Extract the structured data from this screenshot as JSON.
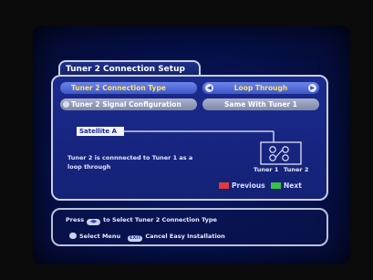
{
  "title": "Tuner 2 Connection Setup",
  "rows": [
    {
      "label": "Tuner 2 Connection Type",
      "value": "Loop Through"
    },
    {
      "label": "Tuner 2 Signal Configuration",
      "value": "Same With Tuner 1"
    }
  ],
  "arrows": {
    "left": "◀",
    "right": "▶"
  },
  "diagram": {
    "satellite_label": "Satellite A",
    "tuner1_label": "Tuner 1",
    "tuner2_label": "Tuner 2"
  },
  "info_text": "Tuner 2 is connnected to Tuner 1 as a loop through",
  "nav": {
    "previous": "Previous",
    "next": "Next"
  },
  "colors": {
    "previous": "#e03a3a",
    "next": "#39c24a",
    "accent": "#ffe36a"
  },
  "help": {
    "press_label": "Press",
    "press_icon": "◀▶",
    "press_text": "to Select Tuner 2 Connection Type",
    "select_text": "Select Menu",
    "exit_icon": "EXIT",
    "exit_text": "Cancel Easy Installation"
  }
}
